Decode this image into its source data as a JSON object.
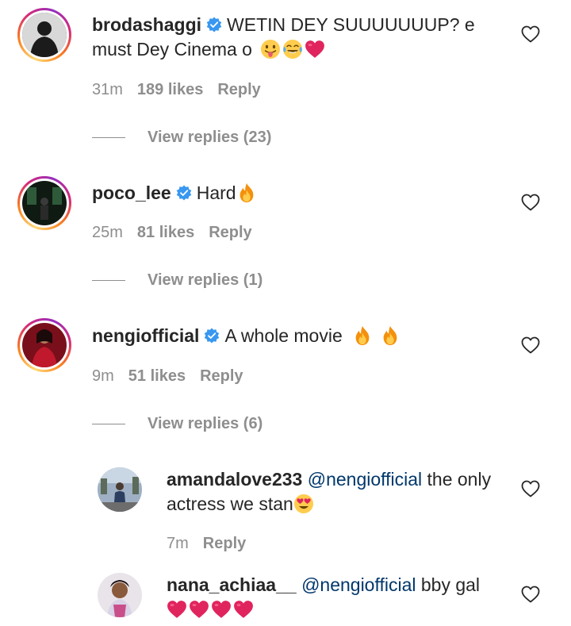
{
  "comments": [
    {
      "username": "brodashaggi",
      "verified": true,
      "text": "WETIN DEY SUUUUUUUP? e must Dey Cinema o",
      "emojis": [
        "tongue-face",
        "tears-of-joy",
        "red-heart"
      ],
      "time": "31m",
      "likes": "189 likes",
      "reply_label": "Reply",
      "view_replies": "View replies (23)"
    },
    {
      "username": "poco_lee",
      "verified": true,
      "text": "Hard",
      "emojis": [
        "fire"
      ],
      "time": "25m",
      "likes": "81 likes",
      "reply_label": "Reply",
      "view_replies": "View replies (1)"
    },
    {
      "username": "nengiofficial",
      "verified": true,
      "text": "A whole movie",
      "emojis": [
        "fire",
        "fire"
      ],
      "time": "9m",
      "likes": "51 likes",
      "reply_label": "Reply",
      "view_replies": "View replies (6)"
    }
  ],
  "replies": [
    {
      "username": "amandalove233",
      "mention": "@nengiofficial",
      "text_after": "the only actress we stan",
      "emojis": [
        "heart-eyes"
      ],
      "time": "7m",
      "reply_label": "Reply"
    },
    {
      "username": "nana_achiaa__",
      "mention": "@nengiofficial",
      "text_after": "bby gal",
      "emojis": [
        "red-heart",
        "red-heart",
        "red-heart",
        "red-heart"
      ]
    }
  ],
  "icons": {
    "like": "heart-outline-icon",
    "verified": "verified-badge-icon"
  },
  "colors": {
    "verified_blue": "#3897f0",
    "meta_gray": "#8e8e8e",
    "mention_blue": "#00376b",
    "heart_red": "#e0245e"
  }
}
